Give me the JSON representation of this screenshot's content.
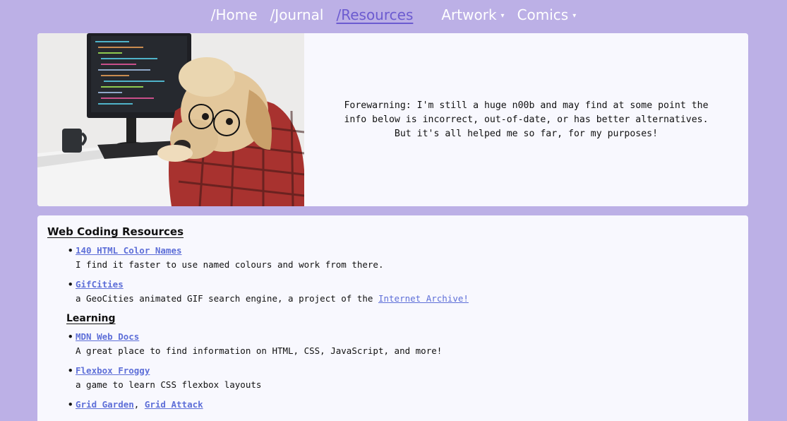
{
  "nav": {
    "items": [
      {
        "label": "/Home",
        "active": false,
        "dropdown": false
      },
      {
        "label": "/Journal",
        "active": false,
        "dropdown": false
      },
      {
        "label": "/Resources",
        "active": true,
        "dropdown": false
      },
      {
        "label": "Artwork",
        "active": false,
        "dropdown": true
      },
      {
        "label": "Comics",
        "active": false,
        "dropdown": true
      }
    ],
    "caret": "▾"
  },
  "hero": {
    "image_icon": "dog-with-glasses-at-computer",
    "lines": [
      "Forewarning: I'm still a huge n00b and may find at some point the",
      "info below is incorrect, out-of-date, or has better alternatives.",
      "But it's all helped me so far, for my purposes!"
    ]
  },
  "section": {
    "title": "Web Coding Resources",
    "bullet": "•",
    "items": [
      {
        "link": "140 HTML Color Names",
        "desc": "I find it faster to use named colours and work from there."
      },
      {
        "link": "GifCities",
        "desc": "a GeoCities animated GIF search engine, a project of the ",
        "desc_link": "Internet Archive!"
      }
    ],
    "subtitle": "Learning",
    "learning": [
      {
        "link": "MDN Web Docs",
        "desc": "A great place to find information on HTML, CSS, JavaScript, and more!"
      },
      {
        "link": "Flexbox Froggy",
        "desc": "a game to learn CSS flexbox layouts"
      },
      {
        "link": "Grid Garden",
        "sep": ", ",
        "link2": "Grid Attack"
      }
    ]
  },
  "colors": {
    "background": "#bcb0e6",
    "panel": "#f8f8fe",
    "link": "#5e6fd8",
    "active_nav": "#6c5bd0"
  }
}
